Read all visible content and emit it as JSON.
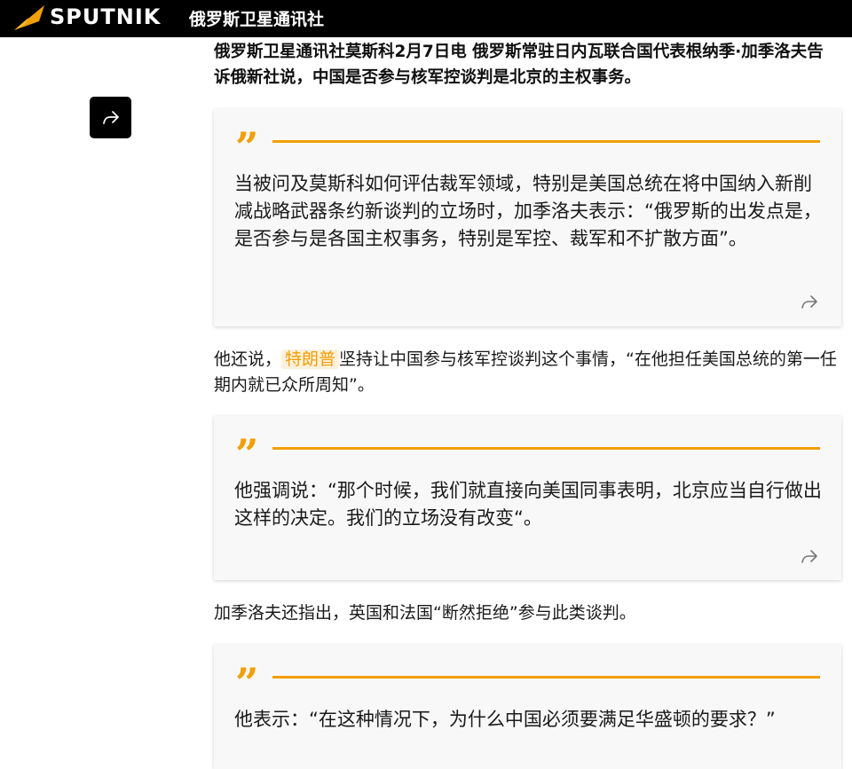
{
  "header": {
    "logo_text": "SPUTNIK",
    "site_name": "俄罗斯卫星通讯社"
  },
  "article": {
    "lead": "俄罗斯卫星通讯社莫斯科2月7日电 俄罗斯常驻日内瓦联合国代表根纳季·加季洛夫告诉俄新社说，中国是否参与核军控谈判是北京的主权事务。",
    "quote1": "当被问及莫斯科如何评估裁军领域，特别是美国总统在将中国纳入新削减战略武器条约新谈判的立场时，加季洛夫表示：“俄罗斯的出发点是，是否参与是各国主权事务，特别是军控、裁军和不扩散方面”。",
    "para1_before": "他还说，",
    "para1_link": "特朗普",
    "para1_after": "坚持让中国参与核军控谈判这个事情，“在他担任美国总统的第一任期内就已众所周知”。",
    "quote2": "他强调说：“那个时候，我们就直接向美国同事表明，北京应当自行做出这样的决定。我们的立场没有改变“。",
    "para2": "加季洛夫还指出，英国和法国“断然拒绝”参与此类谈判。",
    "quote3": "他表示：“在这种情况下，为什么中国必须要满足华盛顿的要求？”"
  },
  "colors": {
    "accent": "#f29f05",
    "header_bg": "#000000",
    "quote_bg": "#f8f8f8"
  },
  "icons": {
    "logo": "sputnik-logo-icon",
    "share": "share-arrow-icon"
  }
}
